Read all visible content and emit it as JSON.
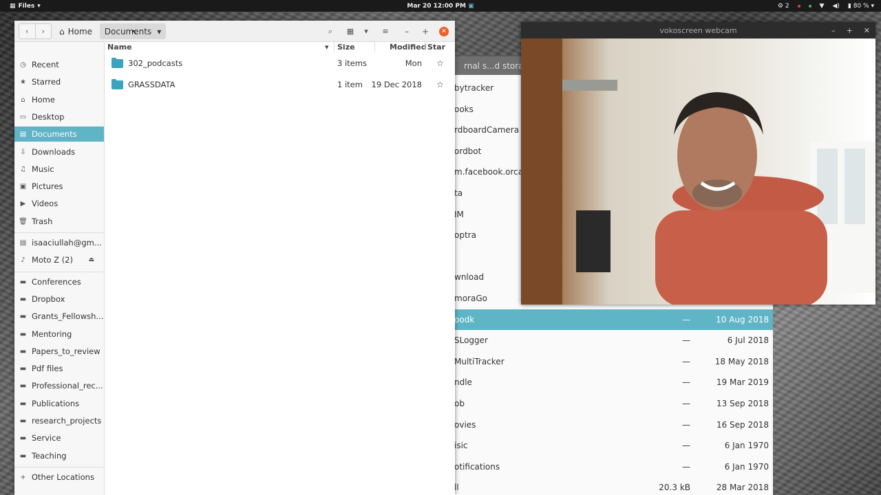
{
  "topbar": {
    "app_name": "Files",
    "clock": "Mar 20  12:00 PM",
    "updates": "2",
    "battery": "80 %"
  },
  "files": {
    "breadcrumb": {
      "home": "Home",
      "current": "Documents"
    },
    "sidebar": [
      {
        "icon": "clock-icon",
        "glyph": "◷",
        "label": "Recent"
      },
      {
        "icon": "star-icon",
        "glyph": "★",
        "label": "Starred"
      },
      {
        "icon": "home-icon",
        "glyph": "⌂",
        "label": "Home"
      },
      {
        "icon": "desktop-icon",
        "glyph": "▭",
        "label": "Desktop"
      },
      {
        "icon": "document-icon",
        "glyph": "▤",
        "label": "Documents",
        "active": true
      },
      {
        "icon": "download-icon",
        "glyph": "⇩",
        "label": "Downloads"
      },
      {
        "icon": "music-icon",
        "glyph": "♫",
        "label": "Music"
      },
      {
        "icon": "picture-icon",
        "glyph": "▣",
        "label": "Pictures"
      },
      {
        "icon": "video-icon",
        "glyph": "▶",
        "label": "Videos"
      },
      {
        "icon": "trash-icon",
        "glyph": "🗑",
        "label": "Trash"
      }
    ],
    "devices": [
      {
        "icon": "network-drive-icon",
        "glyph": "▤",
        "label": "isaaciullah@gm..."
      },
      {
        "icon": "phone-icon",
        "glyph": "♪",
        "label": "Moto Z (2)",
        "eject": "⏏"
      }
    ],
    "bookmarks": [
      "Conferences",
      "Dropbox",
      "Grants_Fellowsh...",
      "Mentoring",
      "Papers_to_review",
      "Pdf files",
      "Professional_rec...",
      "Publications",
      "research_projects",
      "Service",
      "Teaching"
    ],
    "other_locations": "Other Locations",
    "columns": {
      "name": "Name",
      "size": "Size",
      "modified": "Modified",
      "star": "Star"
    },
    "rows": [
      {
        "name": "302_podcasts",
        "size": "3 items",
        "modified": "Mon"
      },
      {
        "name": "GRASSDATA",
        "size": "1 item",
        "modified": "19 Dec 2018"
      }
    ]
  },
  "bg_window": {
    "title": "rnal s...d storage",
    "rows": [
      {
        "name": "bytracker",
        "size": "",
        "date": ""
      },
      {
        "name": "ooks",
        "size": "",
        "date": ""
      },
      {
        "name": "rdboardCamera",
        "size": "",
        "date": ""
      },
      {
        "name": "ordbot",
        "size": "",
        "date": ""
      },
      {
        "name": "m.facebook.orca",
        "size": "",
        "date": ""
      },
      {
        "name": "ta",
        "size": "",
        "date": ""
      },
      {
        "name": "IM",
        "size": "",
        "date": ""
      },
      {
        "name": "optra",
        "size": "",
        "date": ""
      },
      {
        "name": "",
        "size": "",
        "date": ""
      },
      {
        "name": "wnload",
        "size": "",
        "date": ""
      },
      {
        "name": "moraGo",
        "size": "",
        "date": ""
      },
      {
        "name": "oodk",
        "size": "—",
        "date": "10 Aug 2018",
        "selected": true
      },
      {
        "name": "SLogger",
        "size": "—",
        "date": "6 Jul 2018"
      },
      {
        "name": "MultiTracker",
        "size": "—",
        "date": "18 May 2018"
      },
      {
        "name": "ndle",
        "size": "—",
        "date": "19 Mar 2019"
      },
      {
        "name": "ob",
        "size": "—",
        "date": "13 Sep 2018"
      },
      {
        "name": "ovies",
        "size": "—",
        "date": "16 Sep 2018"
      },
      {
        "name": "isic",
        "size": "—",
        "date": "6 Jan 1970"
      },
      {
        "name": "otifications",
        "size": "—",
        "date": "6 Jan 1970"
      },
      {
        "name": "ll",
        "size": "20.3 kB",
        "date": "28 Mar 2018"
      }
    ]
  },
  "webcam": {
    "title": "vokoscreen webcam"
  }
}
